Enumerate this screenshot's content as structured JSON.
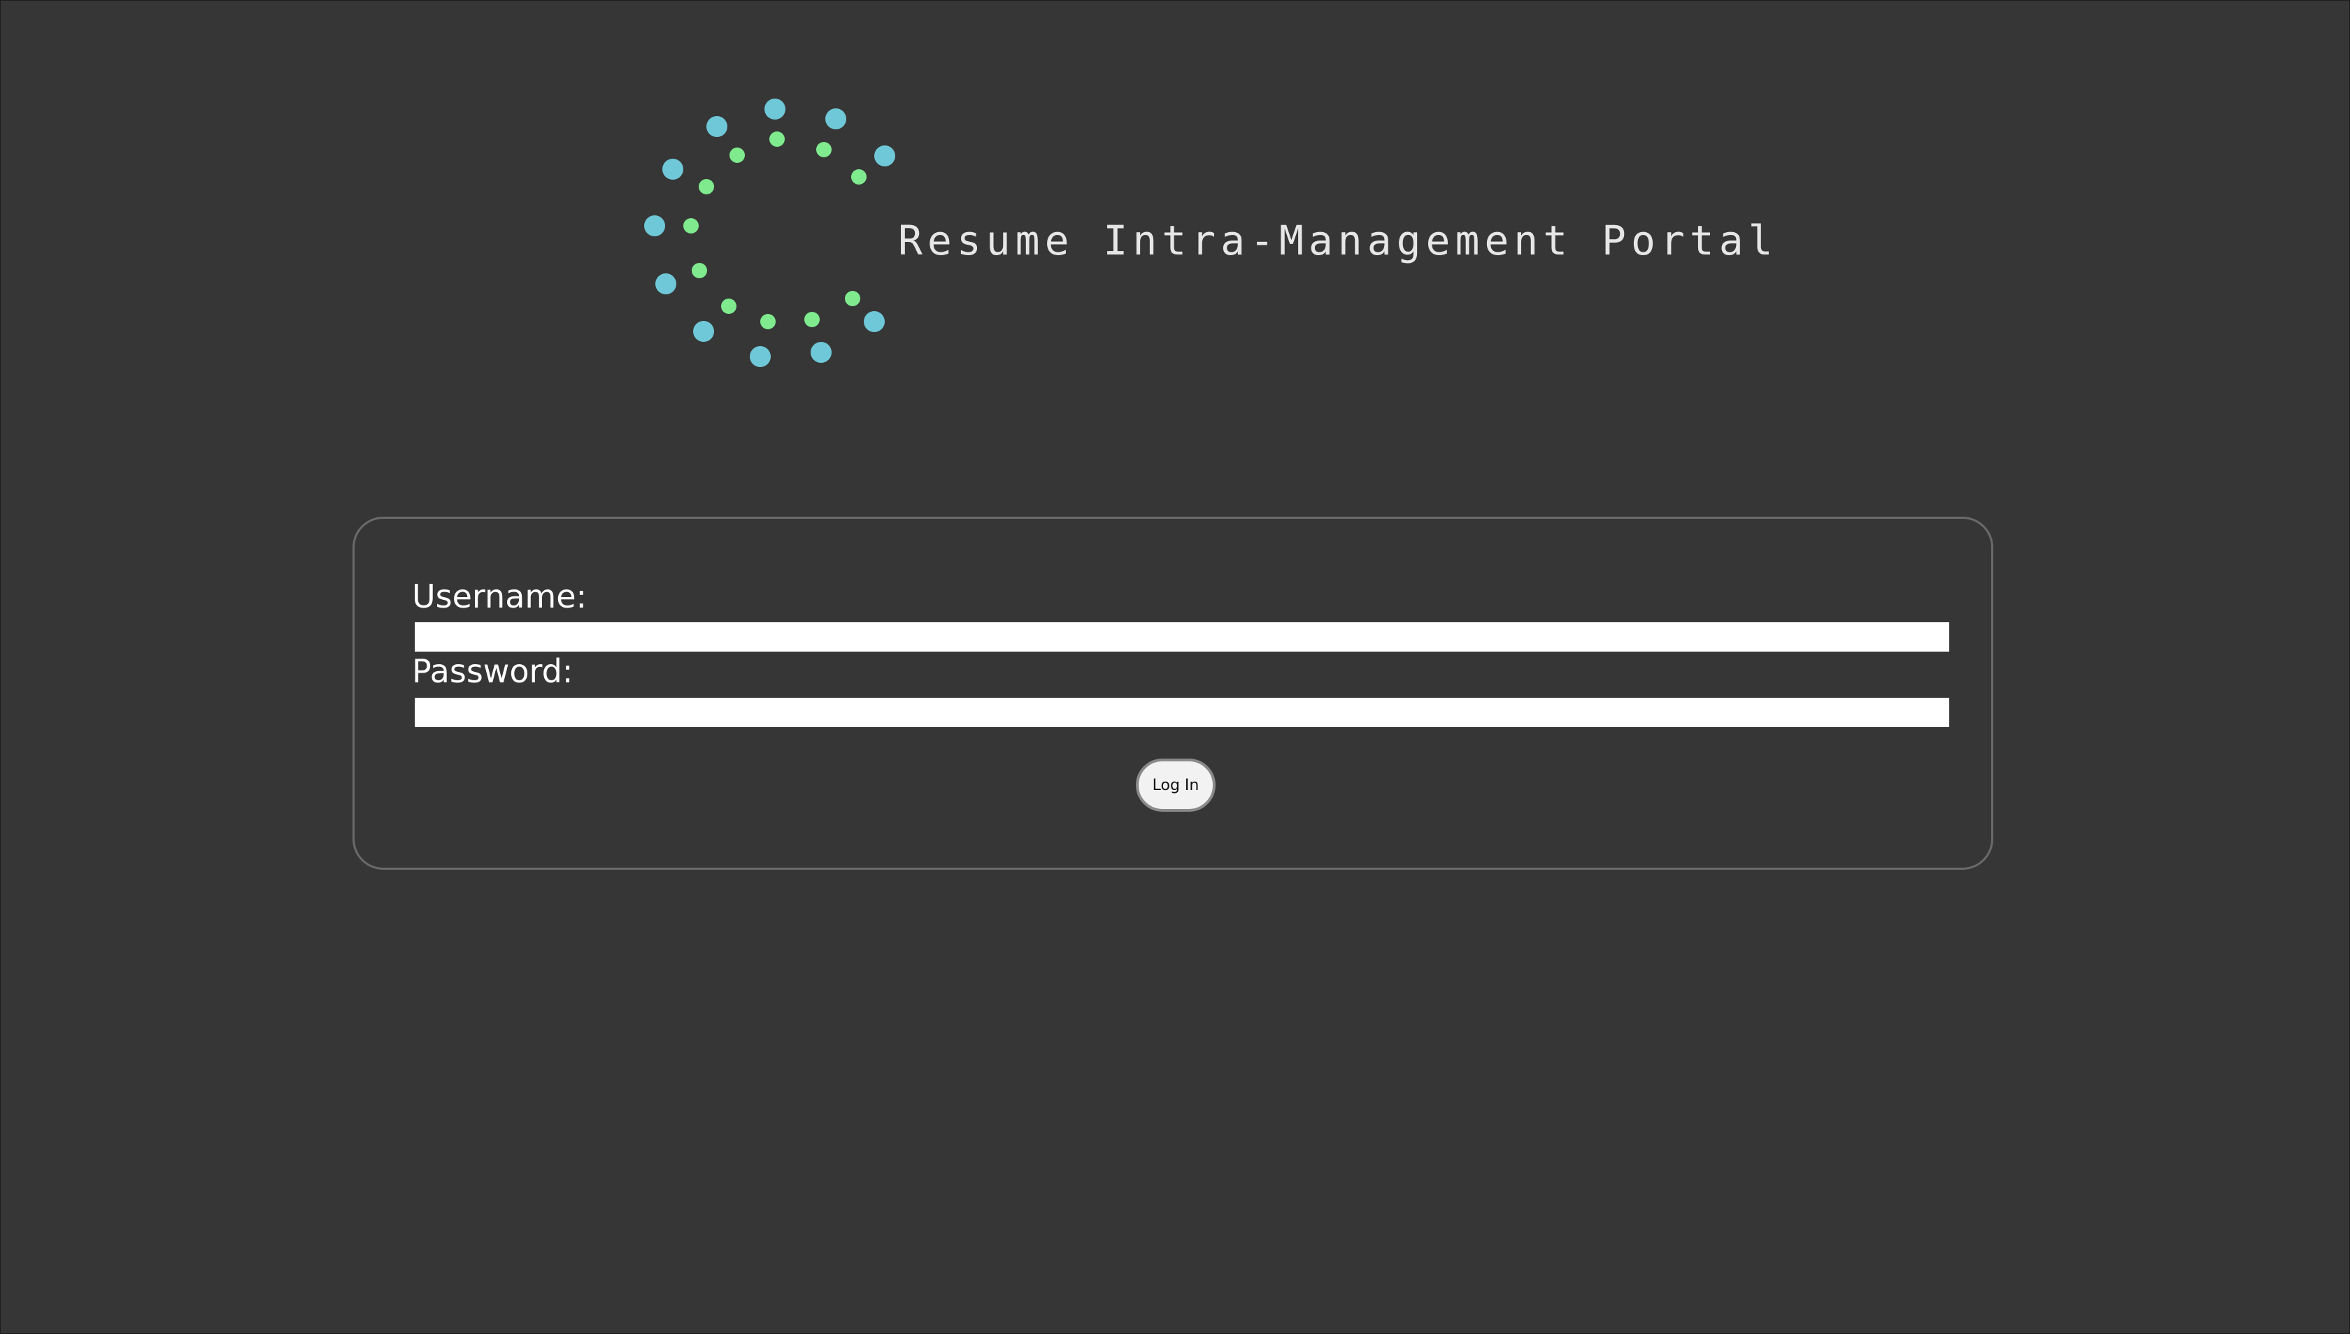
{
  "header": {
    "title": "Resume Intra-Management Portal",
    "logo_icon": "dotted-ring-logo-icon"
  },
  "login_form": {
    "username_label": "Username:",
    "username_value": "",
    "password_label": "Password:",
    "password_value": "",
    "submit_label": "Log In"
  },
  "colors": {
    "background": "#363636",
    "logo_outer_dots": "#6fc8d8",
    "logo_inner_dots": "#7fea8e",
    "title_text": "#e6e6e6",
    "card_border": "#6a6a6a"
  }
}
